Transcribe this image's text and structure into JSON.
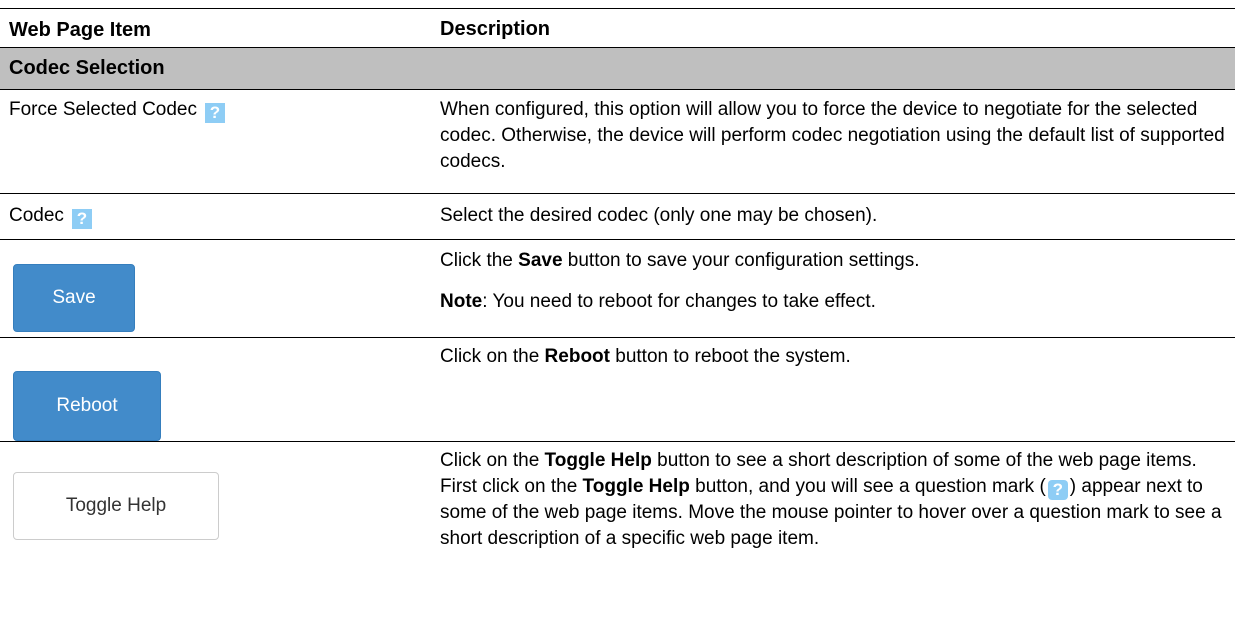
{
  "header": {
    "col_item": "Web Page Item",
    "col_description": "Description"
  },
  "section": {
    "title": "Codec Selection"
  },
  "rows": {
    "force_codec": {
      "item": "Force Selected Codec",
      "help_icon": "question-mark",
      "description": "When configured, this option will allow you to force the device to negotiate for the selected codec. Otherwise, the device will perform codec negotiation using the default list of supported codecs."
    },
    "codec": {
      "item": "Codec",
      "help_icon": "question-mark",
      "description": "Select the desired codec (only one may be chosen)."
    },
    "save": {
      "button_label": "Save",
      "desc_prefix": "Click the ",
      "desc_bold": "Save",
      "desc_suffix": " button to save your configuration settings.",
      "note_bold": "Note",
      "note_text": ": You need to reboot for changes to take effect."
    },
    "reboot": {
      "button_label": "Reboot",
      "desc_prefix": "Click on the ",
      "desc_bold": "Reboot",
      "desc_suffix": " button to reboot the system."
    },
    "toggle_help": {
      "button_label": "Toggle Help",
      "desc_part1": "Click on the ",
      "desc_bold1": "Toggle Help",
      "desc_part2": " button to see a short description of some of the web page items. First click on the ",
      "desc_bold2": "Toggle Help",
      "desc_part3": " button, and you will see a question mark (",
      "desc_part4": ") appear next to some of the web page items. Move the mouse pointer to hover over a question mark to see a short description of a specific web page item."
    }
  },
  "colors": {
    "section_bg": "#bfbfbf",
    "primary_button": "#428bca",
    "help_icon": "#8ecdf5"
  }
}
